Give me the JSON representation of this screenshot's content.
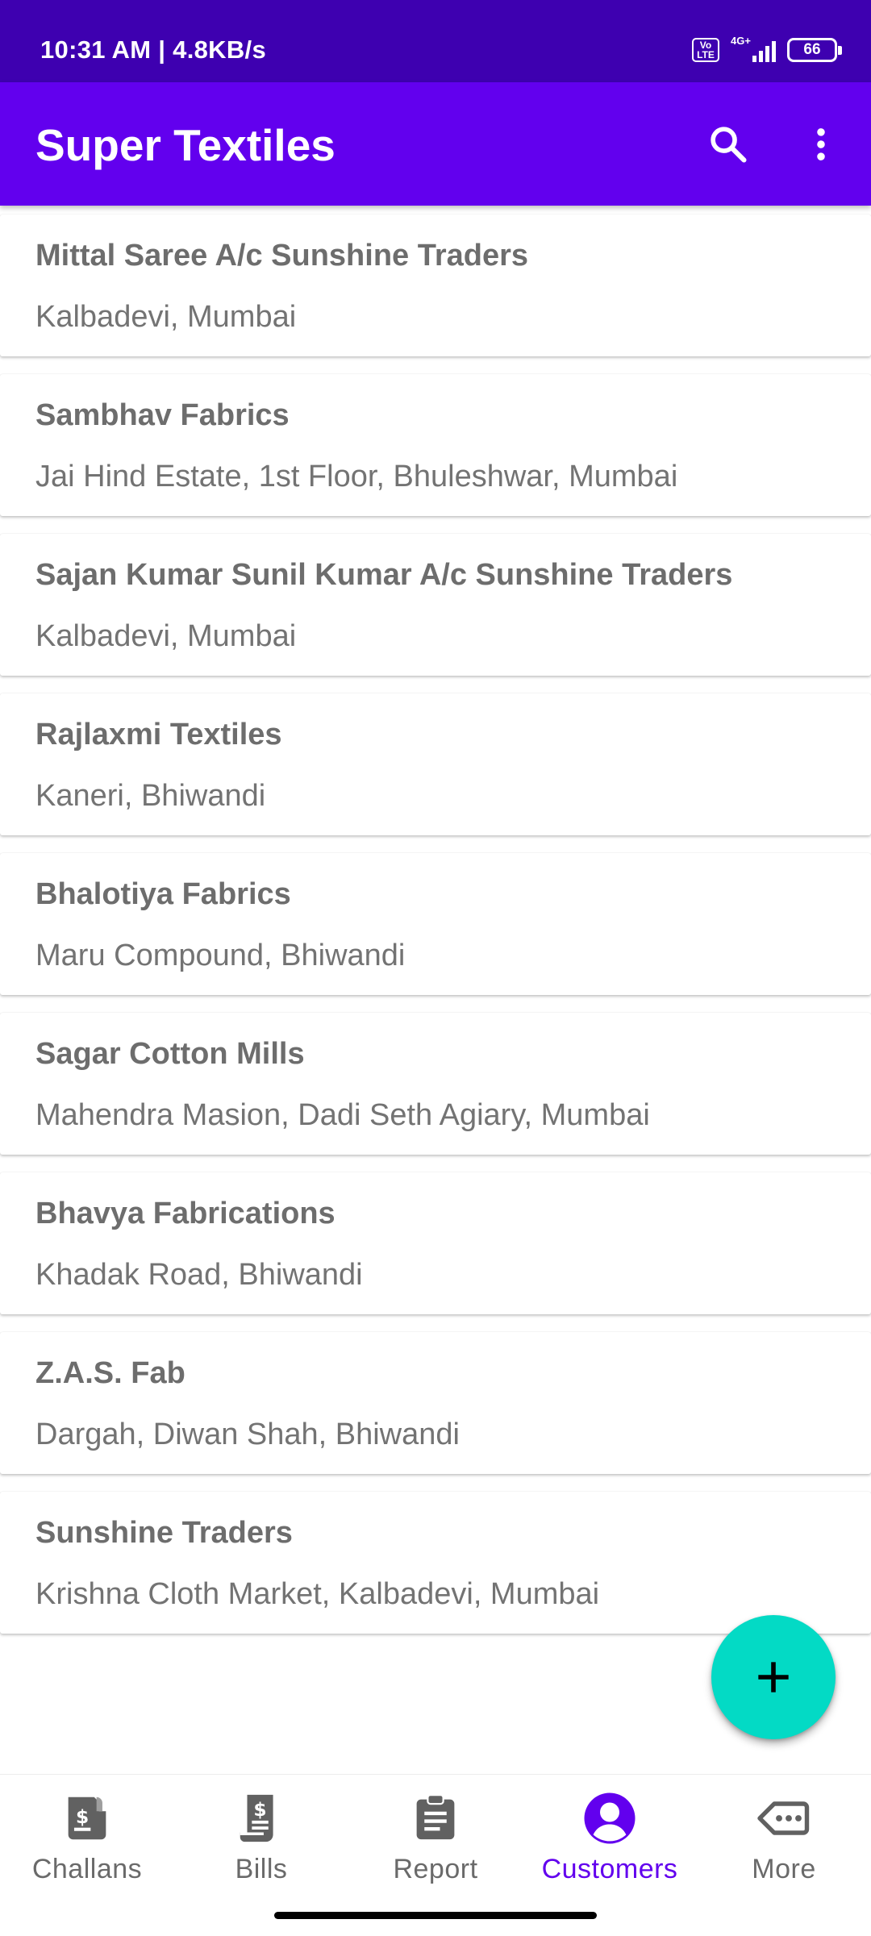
{
  "status_bar": {
    "time": "10:31 AM | 4.8KB/s",
    "network": "4G+",
    "volte_top": "Vo",
    "volte_bottom": "LTE",
    "battery": "66"
  },
  "app_bar": {
    "title": "Super Textiles",
    "color": "#6200ee"
  },
  "customers": [
    {
      "name": "Mittal Saree A/c Sunshine Traders",
      "address": "Kalbadevi, Mumbai"
    },
    {
      "name": "Sambhav Fabrics",
      "address": "Jai Hind Estate, 1st Floor, Bhuleshwar, Mumbai"
    },
    {
      "name": "Sajan Kumar Sunil Kumar A/c Sunshine Traders",
      "address": "Kalbadevi, Mumbai"
    },
    {
      "name": "Rajlaxmi Textiles",
      "address": "Kaneri, Bhiwandi"
    },
    {
      "name": "Bhalotiya Fabrics",
      "address": "Maru Compound, Bhiwandi"
    },
    {
      "name": "Sagar Cotton Mills",
      "address": "Mahendra Masion, Dadi Seth Agiary, Mumbai"
    },
    {
      "name": "Bhavya Fabrications",
      "address": "Khadak Road, Bhiwandi"
    },
    {
      "name": "Z.A.S. Fab",
      "address": "Dargah, Diwan Shah, Bhiwandi"
    },
    {
      "name": "Sunshine Traders",
      "address": "Krishna Cloth Market, Kalbadevi, Mumbai"
    }
  ],
  "fab": {
    "icon": "plus-icon",
    "color": "#03dac5"
  },
  "bottom_nav": {
    "items": [
      {
        "label": "Challans",
        "icon": "challan-icon",
        "active": false
      },
      {
        "label": "Bills",
        "icon": "bill-icon",
        "active": false
      },
      {
        "label": "Report",
        "icon": "clipboard-icon",
        "active": false
      },
      {
        "label": "Customers",
        "icon": "account-icon",
        "active": true
      },
      {
        "label": "More",
        "icon": "more-tag-icon",
        "active": false
      }
    ]
  }
}
